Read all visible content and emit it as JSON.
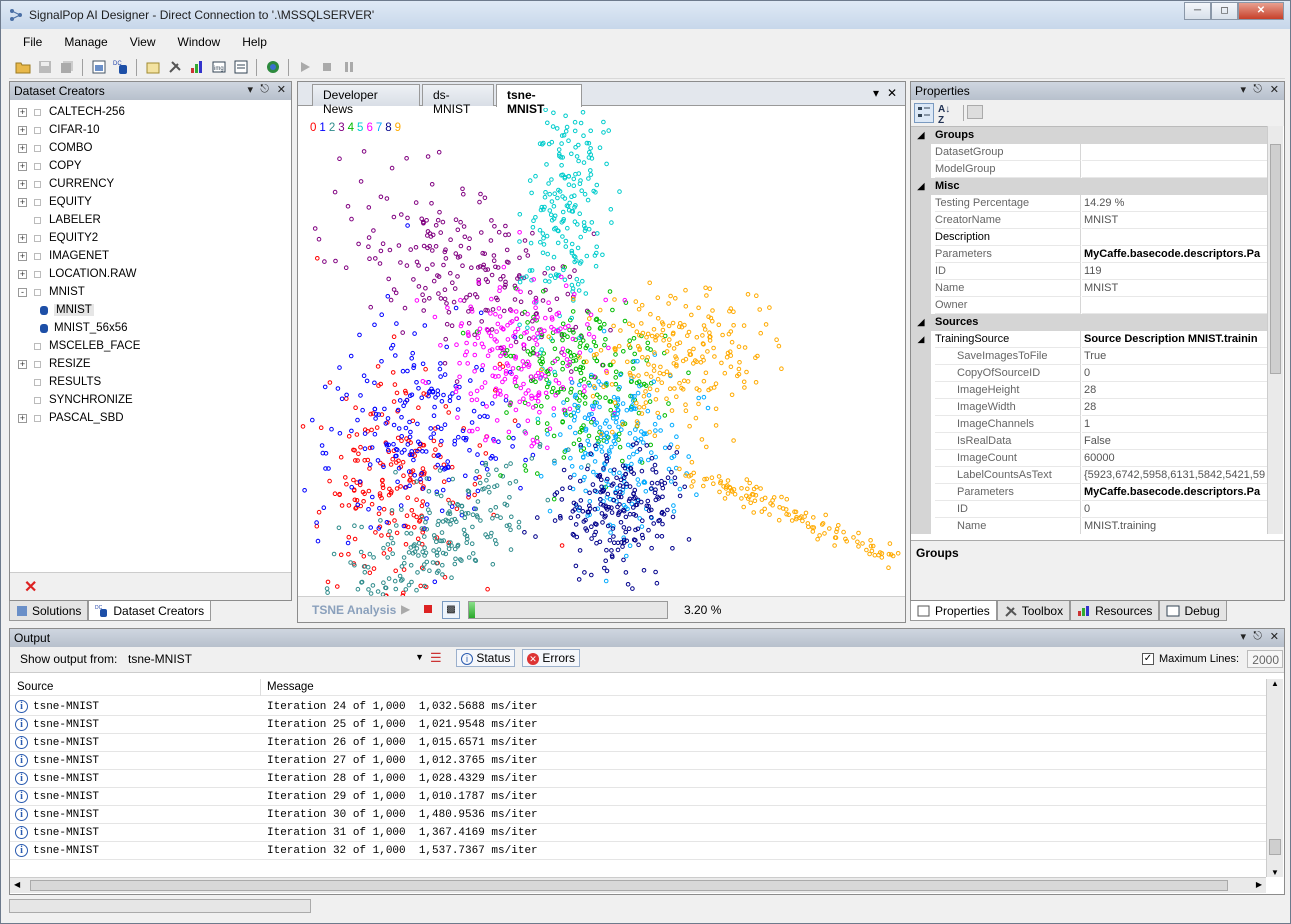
{
  "window": {
    "title": "SignalPop AI Designer - Direct Connection to '.\\MSSQLSERVER'"
  },
  "menu": [
    "File",
    "Manage",
    "View",
    "Window",
    "Help"
  ],
  "left_panel": {
    "title": "Dataset Creators",
    "items": [
      {
        "label": "CALTECH-256",
        "expand": "+"
      },
      {
        "label": "CIFAR-10",
        "expand": "+"
      },
      {
        "label": "COMBO",
        "expand": "+"
      },
      {
        "label": "COPY",
        "expand": "+"
      },
      {
        "label": "CURRENCY",
        "expand": "+"
      },
      {
        "label": "EQUITY",
        "expand": "+"
      },
      {
        "label": "LABELER",
        "expand": ""
      },
      {
        "label": "EQUITY2",
        "expand": "+"
      },
      {
        "label": "IMAGENET",
        "expand": "+"
      },
      {
        "label": "LOCATION.RAW",
        "expand": "+"
      },
      {
        "label": "MNIST",
        "expand": "-"
      },
      {
        "label": "MNIST",
        "child": true,
        "selected": true
      },
      {
        "label": "MNIST_56x56",
        "child": true
      },
      {
        "label": "MSCELEB_FACE",
        "expand": ""
      },
      {
        "label": "RESIZE",
        "expand": "+"
      },
      {
        "label": "RESULTS",
        "expand": ""
      },
      {
        "label": "SYNCHRONIZE",
        "expand": ""
      },
      {
        "label": "PASCAL_SBD",
        "expand": "+"
      }
    ],
    "bottom_tabs": [
      "Solutions",
      "Dataset Creators"
    ]
  },
  "doc_tabs": [
    "Developer News",
    "ds-MNIST",
    "tsne-MNIST"
  ],
  "legend_digits": [
    "0",
    "1",
    "2",
    "3",
    "4",
    "5",
    "6",
    "7",
    "8",
    "9"
  ],
  "colors": {
    "digits": [
      "#ff0000",
      "#0000ff",
      "#2e8b8b",
      "#800080",
      "#00bb00",
      "#00cccc",
      "#ff00ff",
      "#00aaff",
      "#00008b",
      "#ffaa00"
    ]
  },
  "tsne": {
    "label": "TSNE Analysis",
    "progress_pct": 3.2,
    "progress_text": "3.20 %"
  },
  "properties": {
    "title": "Properties",
    "rows": [
      {
        "type": "cat",
        "name": "Groups"
      },
      {
        "name": "DatasetGroup",
        "value": ""
      },
      {
        "name": "ModelGroup",
        "value": ""
      },
      {
        "type": "cat",
        "name": "Misc"
      },
      {
        "name": "Testing Percentage",
        "value": "14.29 %"
      },
      {
        "name": "CreatorName",
        "value": "MNIST"
      },
      {
        "name": "Description",
        "value": "",
        "dark": true
      },
      {
        "name": "Parameters",
        "value": "MyCaffe.basecode.descriptors.Pa",
        "bold": true
      },
      {
        "name": "ID",
        "value": "119"
      },
      {
        "name": "Name",
        "value": "MNIST"
      },
      {
        "name": "Owner",
        "value": ""
      },
      {
        "type": "cat",
        "name": "Sources"
      },
      {
        "name": "TrainingSource",
        "value": "Source Description MNIST.trainin",
        "bold": true,
        "dark": true,
        "expander": true
      },
      {
        "name": "SaveImagesToFile",
        "value": "True",
        "indent": true
      },
      {
        "name": "CopyOfSourceID",
        "value": "0",
        "indent": true
      },
      {
        "name": "ImageHeight",
        "value": "28",
        "indent": true
      },
      {
        "name": "ImageWidth",
        "value": "28",
        "indent": true
      },
      {
        "name": "ImageChannels",
        "value": "1",
        "indent": true
      },
      {
        "name": "IsRealData",
        "value": "False",
        "indent": true
      },
      {
        "name": "ImageCount",
        "value": "60000",
        "indent": true
      },
      {
        "name": "LabelCountsAsText",
        "value": "{5923,6742,5958,6131,5842,5421,59",
        "indent": true
      },
      {
        "name": "Parameters",
        "value": "MyCaffe.basecode.descriptors.Pa",
        "indent": true,
        "bold": true
      },
      {
        "name": "ID",
        "value": "0",
        "indent": true
      },
      {
        "name": "Name",
        "value": "MNIST.training",
        "indent": true
      }
    ],
    "description_title": "Groups",
    "bottom_tabs": [
      "Properties",
      "Toolbox",
      "Resources",
      "Debug"
    ]
  },
  "output": {
    "title": "Output",
    "show_from_label": "Show output from:",
    "show_from_value": "tsne-MNIST",
    "status_btn": "Status",
    "errors_btn": "Errors",
    "max_lines_label": "Maximum Lines:",
    "max_lines_value": "2000",
    "col_source": "Source",
    "col_message": "Message",
    "rows": [
      {
        "source": "tsne-MNIST",
        "message": "Iteration 24 of 1,000  1,032.5688 ms/iter"
      },
      {
        "source": "tsne-MNIST",
        "message": "Iteration 25 of 1,000  1,021.9548 ms/iter"
      },
      {
        "source": "tsne-MNIST",
        "message": "Iteration 26 of 1,000  1,015.6571 ms/iter"
      },
      {
        "source": "tsne-MNIST",
        "message": "Iteration 27 of 1,000  1,012.3765 ms/iter"
      },
      {
        "source": "tsne-MNIST",
        "message": "Iteration 28 of 1,000  1,028.4329 ms/iter"
      },
      {
        "source": "tsne-MNIST",
        "message": "Iteration 29 of 1,000  1,010.1787 ms/iter"
      },
      {
        "source": "tsne-MNIST",
        "message": "Iteration 30 of 1,000  1,480.9536 ms/iter"
      },
      {
        "source": "tsne-MNIST",
        "message": "Iteration 31 of 1,000  1,367.4169 ms/iter"
      },
      {
        "source": "tsne-MNIST",
        "message": "Iteration 32 of 1,000  1,537.7367 ms/iter"
      }
    ]
  }
}
